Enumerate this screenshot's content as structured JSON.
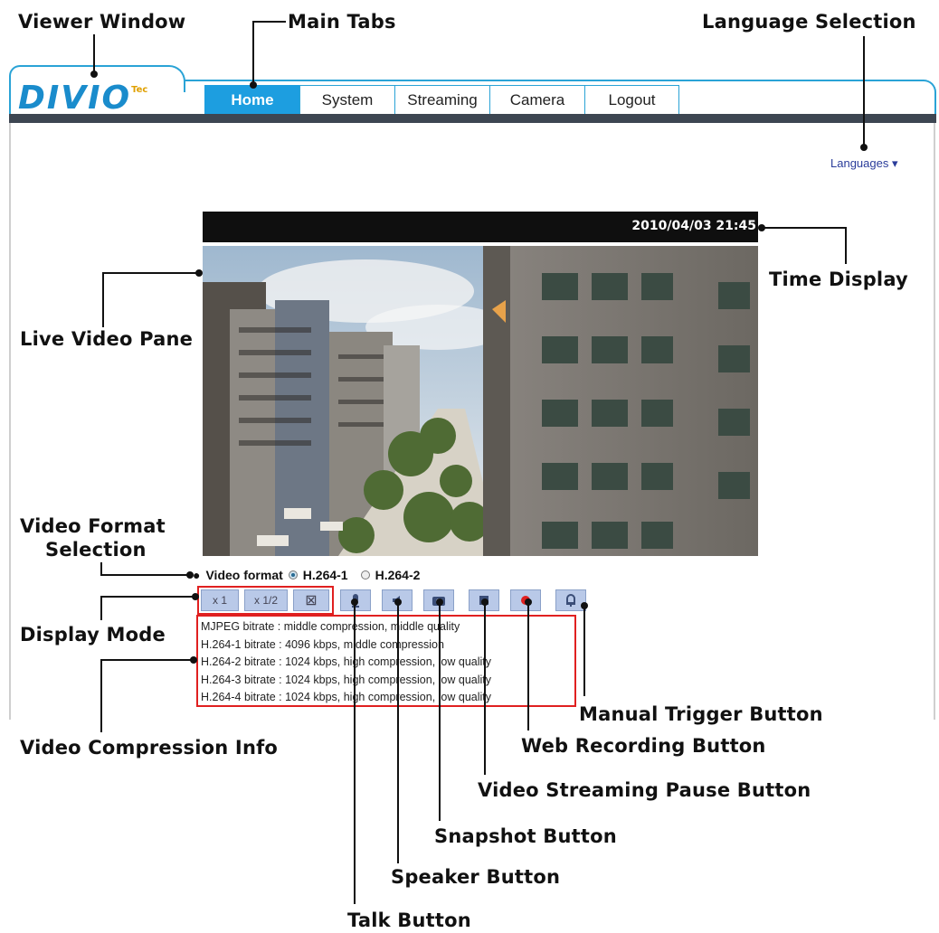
{
  "callouts": {
    "viewer_window": "Viewer Window",
    "main_tabs": "Main Tabs",
    "language_selection": "Language Selection",
    "time_display": "Time Display",
    "live_video_pane": "Live Video Pane",
    "video_format_selection_1": "Video Format",
    "video_format_selection_2": "Selection",
    "display_mode": "Display Mode",
    "video_compression_info": "Video Compression Info",
    "manual_trigger_button": "Manual Trigger Button",
    "web_recording_button": "Web Recording Button",
    "video_streaming_pause_button": "Video Streaming Pause Button",
    "snapshot_button": "Snapshot Button",
    "speaker_button": "Speaker Button",
    "talk_button": "Talk Button"
  },
  "app": {
    "logo_text": "DIVIO",
    "logo_suffix": "Tec"
  },
  "tabs": [
    "Home",
    "System",
    "Streaming",
    "Camera",
    "Logout"
  ],
  "active_tab": "Home",
  "languages_label": "Languages ▾",
  "time_display": "2010/04/03 21:45",
  "video_format": {
    "label": "Video format",
    "options": [
      "H.264-1",
      "H.264-2"
    ],
    "selected": "H.264-1"
  },
  "display_mode": {
    "buttons": [
      "x 1",
      "x 1/2",
      "⊠"
    ]
  },
  "control_icons": [
    "talk-icon",
    "speaker-icon",
    "snapshot-icon",
    "pause-icon",
    "record-icon",
    "trigger-icon"
  ],
  "compression_info": [
    "MJPEG bitrate : middle compression, middle quality",
    "H.264-1 bitrate : 4096 kbps, middle compression",
    "H.264-2 bitrate : 1024 kbps, high compression, low quality",
    "H.264-3 bitrate : 1024 kbps, high compression, low quality",
    "H.264-4 bitrate : 1024 kbps, high compression, low quality"
  ],
  "colors": {
    "accent": "#1d9ee0",
    "frame": "#2aa3d6",
    "tabbar": "#3d4652",
    "highlight_box": "#e02020",
    "button_bg": "#b9c9e8"
  }
}
